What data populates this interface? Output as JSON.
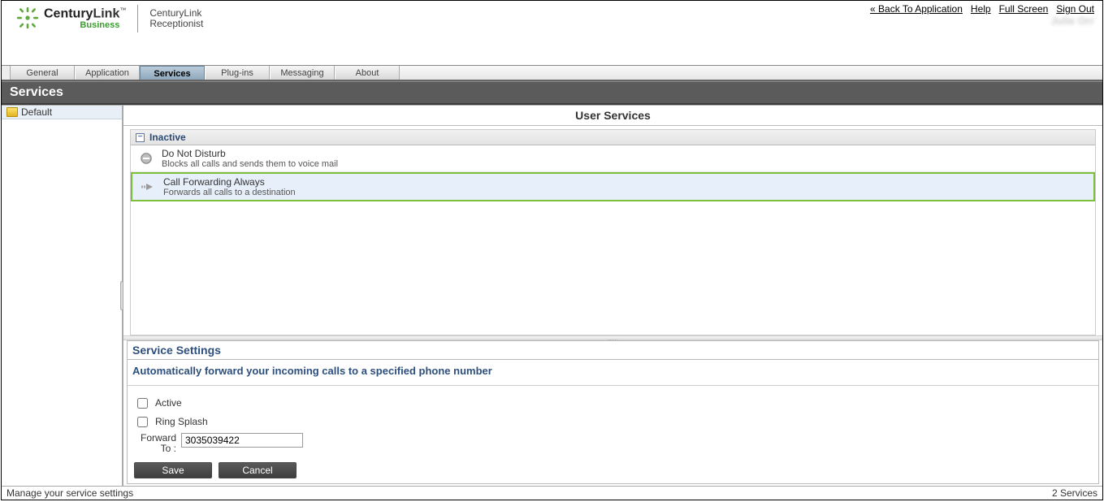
{
  "top_links": {
    "back": "« Back To Application",
    "help": "Help",
    "full_screen": "Full Screen",
    "sign_out": "Sign Out"
  },
  "user_display": "Julie Orr",
  "brand": {
    "name_main": "Century",
    "name_bold": "Link",
    "tm": "™",
    "sub": "Business",
    "product_line1": "CenturyLink",
    "product_line2": "Receptionist"
  },
  "tabs": {
    "general": "General",
    "application": "Application",
    "services": "Services",
    "plugins": "Plug-ins",
    "messaging": "Messaging",
    "about": "About",
    "active": "services"
  },
  "section_title": "Services",
  "sidebar": {
    "items": [
      {
        "label": "Default"
      }
    ]
  },
  "main": {
    "panel_title": "User Services",
    "group_label": "Inactive",
    "services": [
      {
        "id": "dnd",
        "title": "Do Not Disturb",
        "desc": "Blocks all calls and sends them to voice mail",
        "icon": "no-entry",
        "selected": false
      },
      {
        "id": "cfa",
        "title": "Call Forwarding Always",
        "desc": "Forwards all calls to a destination",
        "icon": "forward-arrow",
        "selected": true
      }
    ]
  },
  "settings": {
    "title": "Service Settings",
    "desc": "Automatically forward your incoming calls to a specified phone number",
    "active_label": "Active",
    "active_checked": false,
    "ring_splash_label": "Ring Splash",
    "ring_splash_checked": false,
    "forward_to_label": "Forward To :",
    "forward_to_value": "3035039422",
    "save_label": "Save",
    "cancel_label": "Cancel"
  },
  "status": {
    "left": "Manage your service settings",
    "right": "2 Services"
  }
}
